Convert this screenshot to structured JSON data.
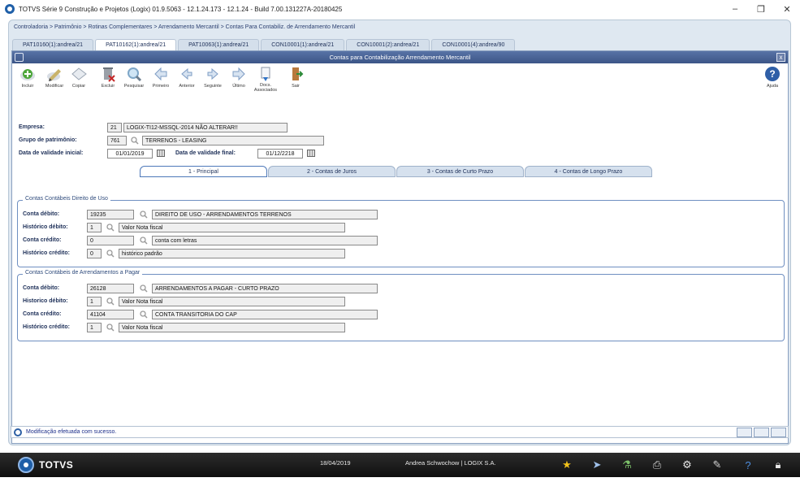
{
  "window": {
    "title": "TOTVS Série 9 Construção e Projetos (Logix) 01.9.5063  -  12.1.24.173 - 12.1.24 - Build 7.00.131227A-20180425",
    "minimize": "–",
    "restore": "❐",
    "close": "✕"
  },
  "breadcrumb": "Controladoria > Patrimônio > Rotinas Complementares > Arrendamento Mercantil > Contas Para Contabiliz. de Arrendamento Mercantil",
  "tabs": [
    {
      "label": "PAT10160(1):andrea/21"
    },
    {
      "label": "PAT10162(1):andrea/21"
    },
    {
      "label": "PAT10063(1):andrea/21"
    },
    {
      "label": "CON10001(1):andrea/21"
    },
    {
      "label": "CON10001(2):andrea/21"
    },
    {
      "label": "CON10001(4):andrea/90"
    }
  ],
  "inner_window": {
    "title": "Contas para Contabilização Arrendamento Mercantil",
    "close": "x"
  },
  "toolbar": {
    "incluir": "Incluir",
    "modificar": "Modificar",
    "copiar": "Copiar",
    "excluir": "Excluir",
    "pesquisar": "Pesquisar",
    "primeiro": "Primeiro",
    "anterior": "Anterior",
    "seguinte": "Seguinte",
    "ultimo": "Último",
    "docs1": "Docs.",
    "docs2": "Associados",
    "sair": "Sair",
    "ajuda": "Ajuda"
  },
  "form": {
    "empresa_label": "Empresa:",
    "empresa_code": "21",
    "empresa_desc": "LOGIX-TI12-MSSQL-2014 NÃO ALTERAR!!",
    "grupo_label": "Grupo de patrimônio:",
    "grupo_code": "761",
    "grupo_desc": "TERRENOS - LEASING",
    "data_ini_label": "Data de validade inicial:",
    "data_ini": "01/01/2019",
    "data_fim_label": "Data de validade final:",
    "data_fim": "01/12/2218"
  },
  "subtabs": [
    {
      "label": "1 - Principal"
    },
    {
      "label": "2 - Contas de Juros"
    },
    {
      "label": "3 - Contas de Curto Prazo"
    },
    {
      "label": "4 - Contas de Longo Prazo"
    }
  ],
  "group1": {
    "title": "Contas Contábeis Direito de Uso",
    "rows": [
      {
        "label": "Conta débito:",
        "code": "19235",
        "desc": "DIREITO DE USO - ARRENDAMENTOS TERRENOS"
      },
      {
        "label": "Histórico débito:",
        "code": "1",
        "desc": "Valor Nota fiscal"
      },
      {
        "label": "Conta crédito:",
        "code": "0",
        "desc": "conta com letras"
      },
      {
        "label": "Histórico crédito:",
        "code": "0",
        "desc": "histórico padrão"
      }
    ]
  },
  "group2": {
    "title": "Contas Contábeis de Arrendamentos a Pagar",
    "rows": [
      {
        "label": "Conta débito:",
        "code": "26128",
        "desc": "ARRENDAMENTOS A PAGAR - CURTO PRAZO"
      },
      {
        "label": "Historico débito:",
        "code": "1",
        "desc": "Valor Nota fiscal"
      },
      {
        "label": "Conta crédito:",
        "code": "41104",
        "desc": "CONTA TRANSITORIA DO CAP"
      },
      {
        "label": "Histórico crédito:",
        "code": "1",
        "desc": "Valor Nota fiscal"
      }
    ]
  },
  "status": {
    "message": "Modificação efetuada com sucesso."
  },
  "taskbar": {
    "brand": "TOTVS",
    "date": "18/04/2019",
    "user": "Andrea Schwochow | LOGIX S.A."
  },
  "colors": {
    "accent": "#3b5587",
    "link": "#1d2f58",
    "border": "#6f8fc1"
  }
}
